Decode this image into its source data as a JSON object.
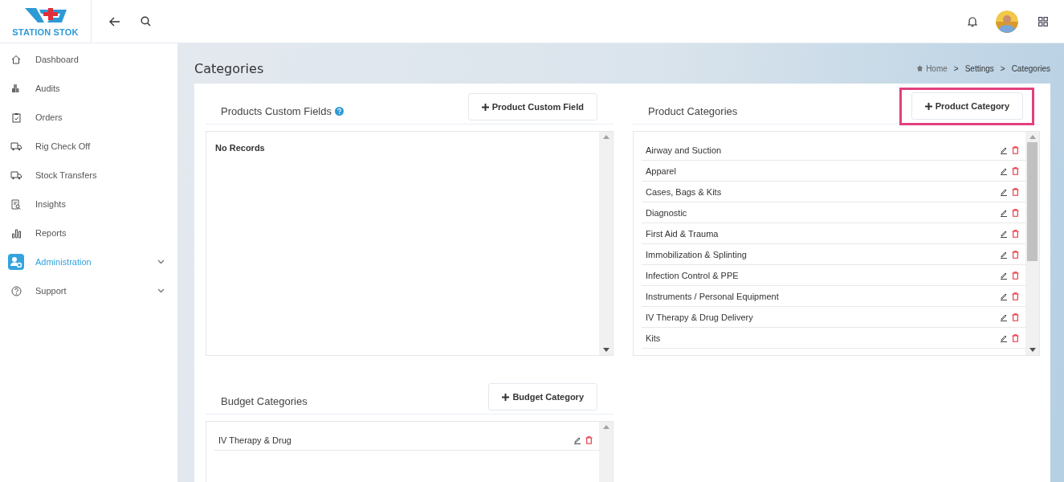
{
  "brand": {
    "name": "STATION STOK"
  },
  "sidebar": {
    "items": [
      {
        "label": "Dashboard",
        "selected": false,
        "expandable": false
      },
      {
        "label": "Audits",
        "selected": false,
        "expandable": false
      },
      {
        "label": "Orders",
        "selected": false,
        "expandable": false
      },
      {
        "label": "Rig Check Off",
        "selected": false,
        "expandable": false
      },
      {
        "label": "Stock Transfers",
        "selected": false,
        "expandable": false
      },
      {
        "label": "Insights",
        "selected": false,
        "expandable": false
      },
      {
        "label": "Reports",
        "selected": false,
        "expandable": false
      },
      {
        "label": "Administration",
        "selected": true,
        "expandable": true
      },
      {
        "label": "Support",
        "selected": false,
        "expandable": true
      }
    ]
  },
  "page": {
    "title": "Categories",
    "breadcrumb": [
      "Home",
      "Settings",
      "Categories"
    ],
    "separator": ">"
  },
  "panels": [
    {
      "title": "Products Custom Fields",
      "help": true,
      "button": "Product Custom Field",
      "highlighted": false,
      "empty_text": "No Records"
    },
    {
      "title": "Product Categories",
      "help": false,
      "button": "Product Category",
      "highlighted": true,
      "rows": [
        "Airway and Suction",
        "Apparel",
        "Cases, Bags & Kits",
        "Diagnostic",
        "First Aid & Trauma",
        "Immobilization & Splinting",
        "Infection Control & PPE",
        "Instruments / Personal Equipment",
        "IV Therapy & Drug Delivery",
        "Kits"
      ]
    },
    {
      "title": "Budget Categories",
      "help": false,
      "button": "Budget Category",
      "highlighted": false,
      "rows": [
        "IV Therapy & Drug"
      ]
    }
  ]
}
